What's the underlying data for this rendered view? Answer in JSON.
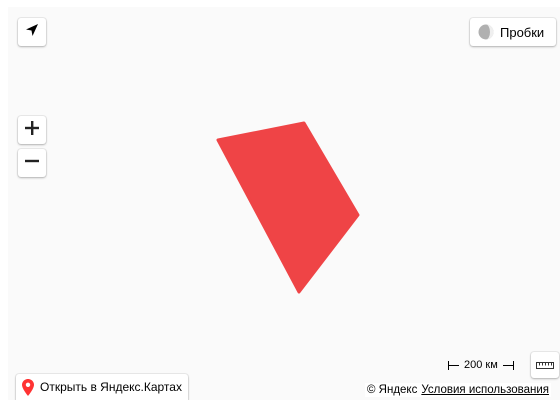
{
  "controls": {
    "traffic_label": "Пробки",
    "open_label": "Открыть в Яндекс.Картах"
  },
  "scale": {
    "label": "200 км"
  },
  "copyright": {
    "brand": "© Яндекс",
    "terms": "Условия использования"
  },
  "overlay": {
    "fill_color": "#ef4446"
  },
  "icons": {
    "geolocation": "navigation-arrow-icon",
    "zoom_in": "plus-icon",
    "zoom_out": "minus-icon",
    "traffic": "traffic-light-icon",
    "ruler": "ruler-icon",
    "open": "map-pin-icon"
  }
}
